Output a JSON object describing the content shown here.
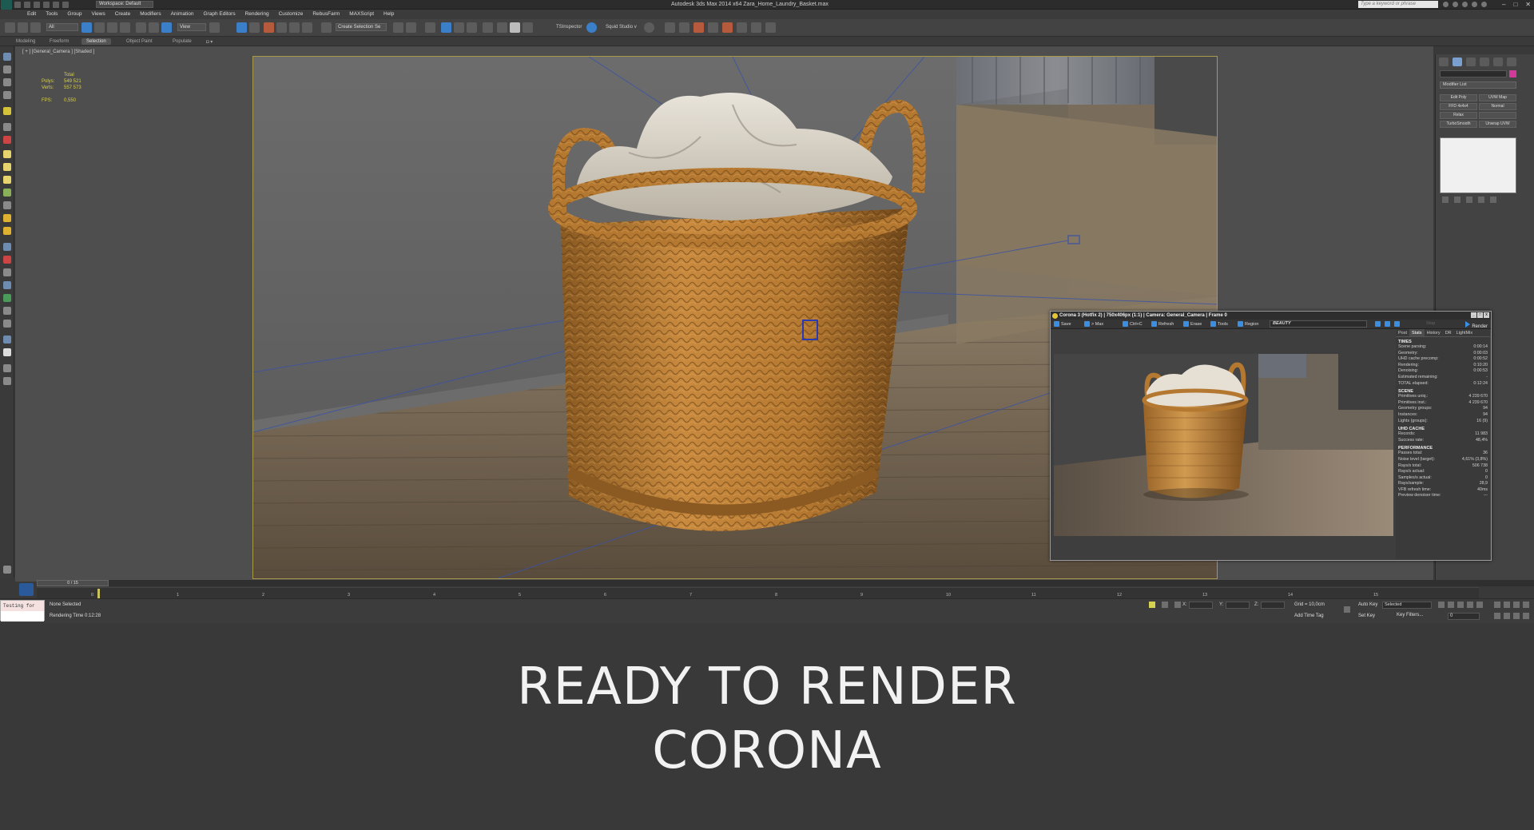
{
  "window": {
    "title": "Autodesk 3ds Max 2014 x64    Zara_Home_Laundry_Basket.max",
    "workspace": "Workspace: Default",
    "search_placeholder": "Type a keyword or phrase"
  },
  "menu": [
    "Edit",
    "Tools",
    "Group",
    "Views",
    "Create",
    "Modifiers",
    "Animation",
    "Graph Editors",
    "Rendering",
    "Customize",
    "RebusFarm",
    "MAXScript",
    "Help"
  ],
  "toolbar": {
    "filter_value": "All",
    "refcoord_value": "View",
    "selection_set_placeholder": "Create Selection Se",
    "tsinspector_label": "TSInspector",
    "squid_label": "Squid Studio v"
  },
  "ribbon_tabs": [
    "Modeling",
    "Freeform",
    "Selection",
    "Object Paint",
    "Populate"
  ],
  "viewport": {
    "label": "[ + ] [General_Camera ] [Shaded ]",
    "stats": {
      "total_label": "Total",
      "polys_label": "Polys:",
      "polys_value": "549 521",
      "verts_label": "Verts:",
      "verts_value": "557 573",
      "fps_label": "FPS:",
      "fps_value": "0,550"
    }
  },
  "command_panel": {
    "modifier_list": "Modifier List",
    "buttons": [
      "Edit Poly",
      "UVW Map",
      "FFD 4x4x4",
      "Normal",
      "Relax",
      "",
      "TurboSmooth",
      "Unwrap UVW"
    ]
  },
  "vfb": {
    "title": "Corona 3 (Hotfix 2) | 750x406px (1:1) | Camera: General_Camera | Frame 0",
    "tools": [
      "Save",
      "> Max",
      "Ctrl+C",
      "Refresh",
      "Erase",
      "Tools",
      "Region"
    ],
    "render_element": "BEAUTY",
    "stop_label": "Stop",
    "render_label": "Render",
    "side_tabs": [
      "Post",
      "Stats",
      "History",
      "DR",
      "LightMix"
    ],
    "sections": [
      {
        "title": "TIMES",
        "rows": [
          [
            "Scene parsing:",
            "0:00:14"
          ],
          [
            "Geometry:",
            "0:00:03"
          ],
          [
            "UHD cache precomp:",
            "0:00:52"
          ],
          [
            "Rendering:",
            "0:10:20"
          ],
          [
            "Denoising:",
            "0:00:53"
          ],
          [
            "Estimated remaining:",
            "-"
          ],
          [
            "TOTAL elapsed:",
            "0:12:24"
          ]
        ]
      },
      {
        "title": "SCENE",
        "rows": [
          [
            "Primitives uniq.:",
            "4 239 670"
          ],
          [
            "Primitives inst.:",
            "4 239 670"
          ],
          [
            "Geometry groups:",
            "94"
          ],
          [
            "Instances:",
            "94"
          ],
          [
            "Lights (groups):",
            "16 (9)"
          ]
        ]
      },
      {
        "title": "UHD CACHE",
        "rows": [
          [
            "Records:",
            "11 983"
          ],
          [
            "Success rate:",
            "48,4%"
          ]
        ]
      },
      {
        "title": "PERFORMANCE",
        "rows": [
          [
            "Passes total:",
            "36"
          ],
          [
            "Noise level (target):",
            "4,61% (3,8%)"
          ],
          [
            "Rays/s total:",
            "506 738"
          ],
          [
            "Rays/s actual:",
            "0"
          ],
          [
            "Samples/s actual:",
            "0"
          ],
          [
            "Rays/sample:",
            "28,9"
          ],
          [
            "VFB refresh time:",
            "40ms"
          ],
          [
            "Preview denoiser time:",
            "---"
          ]
        ]
      }
    ]
  },
  "timeline": {
    "slider": "0 / 15",
    "ticks": [
      "0",
      "1",
      "2",
      "3",
      "4",
      "5",
      "6",
      "7",
      "8",
      "9",
      "10",
      "11",
      "12",
      "13",
      "14",
      "15"
    ]
  },
  "status": {
    "maxscript_line1": "Testing for",
    "maxscript_line2": "",
    "selected": "None Selected",
    "rendering_time": "Rendering Time  0:12:28",
    "x_label": "X:",
    "y_label": "Y:",
    "z_label": "Z:",
    "grid": "Grid = 10,0cm",
    "add_time_tag": "Add Time Tag",
    "auto_key": "Auto Key",
    "set_key": "Set Key",
    "selected_drop": "Selected",
    "key_filters": "Key Filters...",
    "frame_value": "0"
  },
  "caption": {
    "line1": "READY TO RENDER",
    "line2": "CORONA"
  },
  "colors": {
    "accent_blue": "#3a7fc8",
    "safe_frame": "#a99a4a",
    "stats_yellow": "#d8d050"
  }
}
